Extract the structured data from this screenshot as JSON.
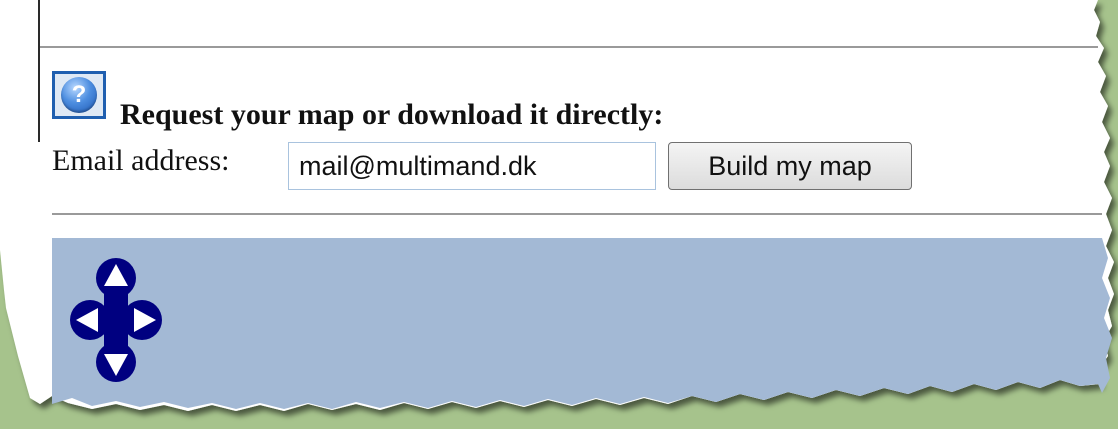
{
  "help": {
    "glyph": "?",
    "icon": "help-question-icon"
  },
  "request": {
    "heading": "Request your map or download it directly:"
  },
  "form": {
    "email_label": "Email address:",
    "email_value": "mail@multimand.dk",
    "build_button_label": "Build my map"
  },
  "map": {
    "background_color": "#a3b9d5",
    "pan_control_color": "#000080",
    "pan_icons": [
      "arrow-up-icon",
      "arrow-left-icon",
      "arrow-right-icon",
      "arrow-down-icon"
    ]
  },
  "colors": {
    "backdrop": "#a6c38c",
    "page": "#ffffff",
    "accent": "#1f5fb0"
  }
}
